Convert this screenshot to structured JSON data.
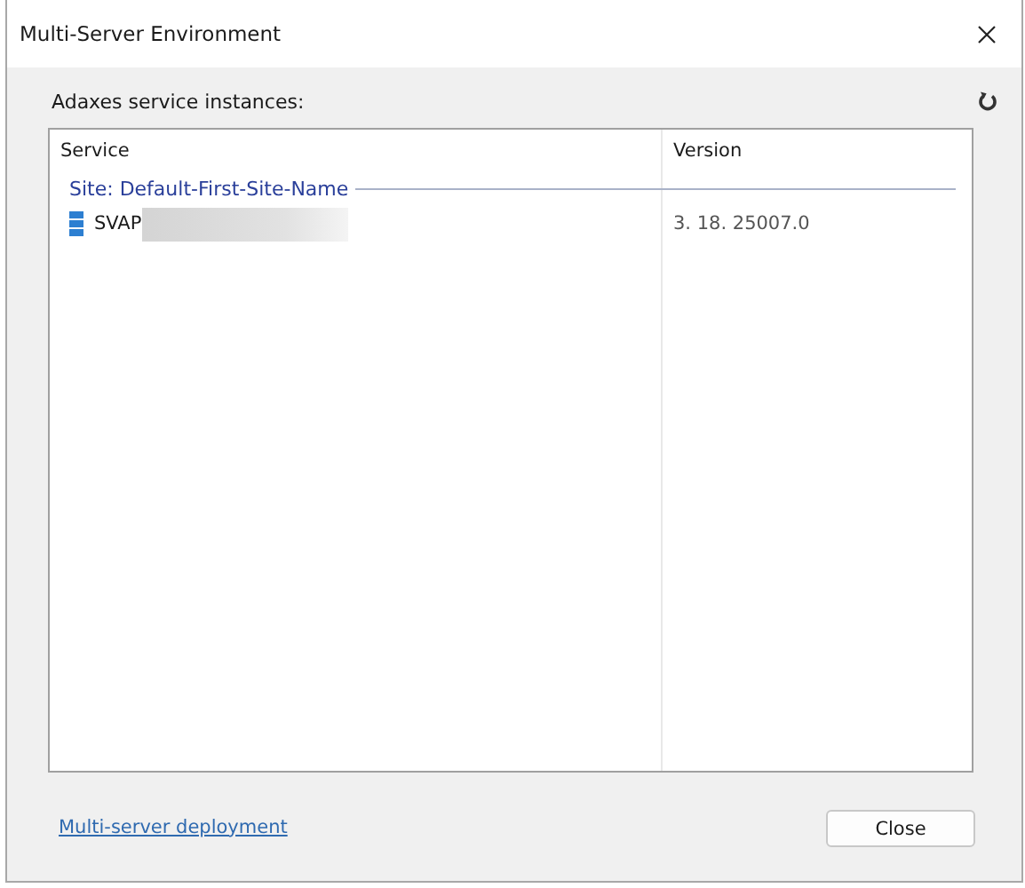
{
  "window": {
    "title": "Multi-Server Environment"
  },
  "label": "Adaxes service instances:",
  "table": {
    "columns": [
      "Service",
      "Version"
    ],
    "groups": [
      {
        "title": "Site: Default-First-Site-Name",
        "rows": [
          {
            "service": "SVAP",
            "version": "3. 18. 25007.0",
            "redacted": true
          }
        ]
      }
    ]
  },
  "link": "Multi-server deployment",
  "buttons": [
    "Close"
  ]
}
